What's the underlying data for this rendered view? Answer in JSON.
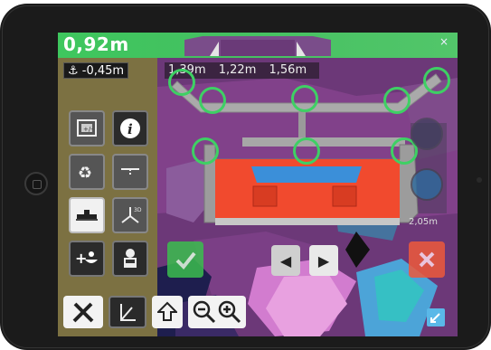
{
  "header": {
    "main_value": "0,92m",
    "close_glyph": "×"
  },
  "offset": {
    "label": "⚓ -0,45m",
    "icon": "hook-icon"
  },
  "distances": [
    "1,39m",
    "1,22m",
    "1,56m"
  ],
  "side_reading": "2,05m",
  "colors": {
    "header": "#3ec75e",
    "panel": "#7e763e",
    "ok": "#3bbd4e",
    "cancel": "#ee5a3c",
    "map_purple": "#6f3a78",
    "target_circle": "#3ed064"
  },
  "tools": [
    {
      "name": "zoom-frame-button",
      "icon": "frame-plus-minus-icon"
    },
    {
      "name": "info-button",
      "icon": "info-icon"
    },
    {
      "name": "recycle-button",
      "icon": "recycle-icon"
    },
    {
      "name": "level-button",
      "icon": "level-icon"
    },
    {
      "name": "boom-button",
      "icon": "boom-icon"
    },
    {
      "name": "3d-axis-button",
      "icon": "axis-3d-icon"
    },
    {
      "name": "add-bucket-button",
      "icon": "bucket-plus-icon"
    },
    {
      "name": "operator-button",
      "icon": "operator-icon"
    }
  ],
  "bottom": {
    "tools_icon": "tools-icon",
    "measure_icon": "angle-icon",
    "up_icon": "arrow-up-icon",
    "zoom_out_icon": "zoom-out-icon",
    "zoom_in_icon": "zoom-in-icon",
    "expand_icon": "expand-icon"
  },
  "nav": {
    "left": "◀",
    "right": "▶"
  }
}
